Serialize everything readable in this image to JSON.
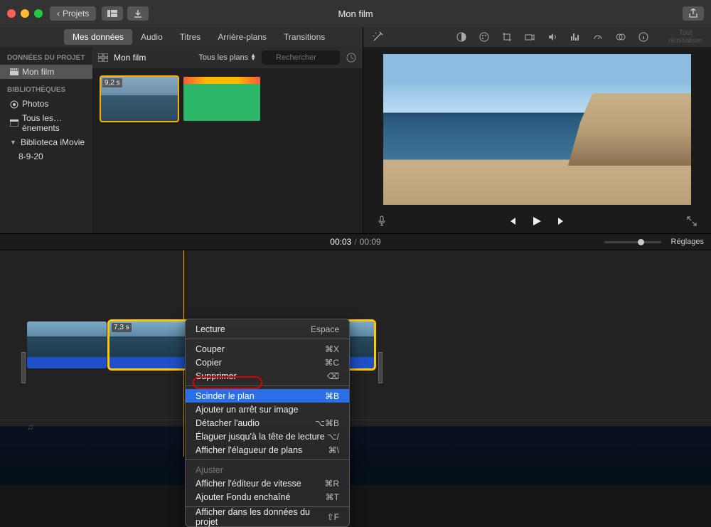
{
  "window": {
    "title": "Mon film"
  },
  "toolbar": {
    "back_label": "Projets",
    "reset_line1": "Tout",
    "reset_line2": "réinitialiser"
  },
  "tabs": {
    "my_media": "Mes données",
    "audio": "Audio",
    "titles": "Titres",
    "backgrounds": "Arrière-plans",
    "transitions": "Transitions"
  },
  "sidebar": {
    "project_data_header": "DONNÉES DU PROJET",
    "project_name": "Mon film",
    "libraries_header": "BIBLIOTHÈQUES",
    "photos": "Photos",
    "all_events": "Tous les…énements",
    "library_name": "Biblioteca iMovie",
    "event_date": "8-9-20"
  },
  "browser": {
    "title": "Mon film",
    "filter_label": "Tous les plans",
    "search_placeholder": "Rechercher",
    "clip1_duration": "9,2 s"
  },
  "timecode": {
    "current": "00:03",
    "total": "00:09",
    "settings": "Réglages"
  },
  "timeline": {
    "clip2_duration": "7,3 s"
  },
  "context_menu": {
    "play": "Lecture",
    "play_sc": "Espace",
    "cut": "Couper",
    "cut_sc": "⌘X",
    "copy": "Copier",
    "copy_sc": "⌘C",
    "delete": "Supprimer",
    "delete_sc": "⌫",
    "split": "Scinder le plan",
    "split_sc": "⌘B",
    "freeze": "Ajouter un arrêt sur image",
    "detach": "Détacher l'audio",
    "detach_sc": "⌥⌘B",
    "trim": "Élaguer jusqu'à la tête de lecture",
    "trim_sc": "⌥/",
    "show_trimmer": "Afficher l'élagueur de plans",
    "show_trimmer_sc": "⌘\\",
    "adjust": "Ajuster",
    "speed": "Afficher l'éditeur de vitesse",
    "speed_sc": "⌘R",
    "crossfade": "Ajouter Fondu enchaîné",
    "crossfade_sc": "⌘T",
    "reveal": "Afficher dans les données du projet",
    "reveal_sc": "⇧F"
  }
}
